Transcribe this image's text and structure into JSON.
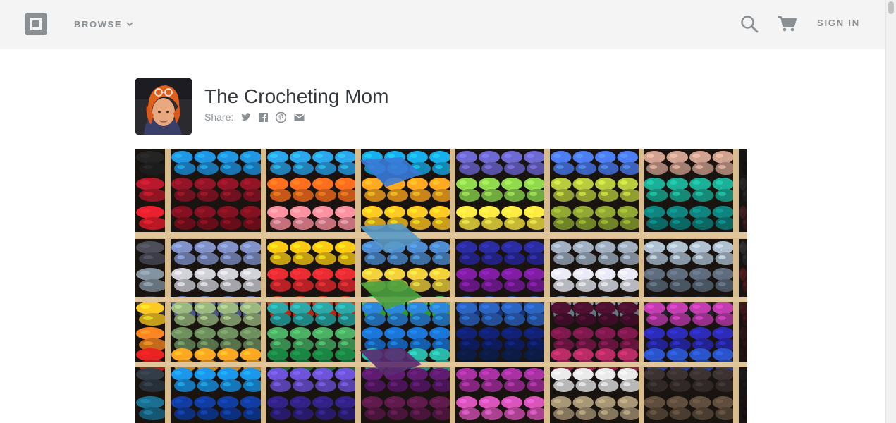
{
  "header": {
    "browse_label": "BROWSE",
    "signin_label": "SIGN IN",
    "icons": [
      "square-logo-icon",
      "chevron-down-icon",
      "search-icon",
      "cart-icon"
    ]
  },
  "store": {
    "title": "The Crocheting Mom",
    "share_label": "Share:",
    "share_icons": [
      "twitter-icon",
      "facebook-icon",
      "pinterest-icon",
      "email-icon"
    ]
  },
  "colors": {
    "header_bg": "#f4f4f4",
    "header_text": "#8a8f94",
    "title_text": "#33383d"
  },
  "hero": {
    "subject": "yarn shelves",
    "yarn_cells": [
      [
        "#222222",
        "#1f8fd8",
        "#2a9fe0",
        "#18a7e0",
        "#6a64c8",
        "#4a78e8",
        "#c89a8a",
        "#111111"
      ],
      [
        "#b0182a",
        "#8a1424",
        "#f06a1c",
        "#f6a21e",
        "#8ad04a",
        "#b0c23a",
        "#1aa890",
        "#222222"
      ],
      [
        "#e01e2c",
        "#7e1020",
        "#f08a98",
        "#f7c020",
        "#f2e040",
        "#8aa030",
        "#0f7f7a",
        "#3a1c1c"
      ],
      [
        "#4a4a56",
        "#7c8cc0",
        "#f0c214",
        "#4a86c8",
        "#2a2a9a",
        "#9aa8b8",
        "#a8b8c8",
        "#2a2a2a"
      ],
      [
        "#7e8c98",
        "#c8c8d0",
        "#e02a30",
        "#e8c83a",
        "#7a1c9a",
        "#e0e0ea",
        "#5a6878",
        "#481818"
      ],
      [
        "#3a3a44",
        "#5a6aa0",
        "#d8321a",
        "#3ab84a",
        "#1d4090",
        "#8090a0",
        "#242830",
        "#2a2a2a"
      ],
      [
        "#f0c020",
        "#94b07a",
        "#2aa0a0",
        "#2a80d0",
        "#2a60b8",
        "#4a1030",
        "#b83aa8",
        "#3a1616"
      ],
      [
        "#f08020",
        "#6a8a5a",
        "#48a860",
        "#1a70d0",
        "#102070",
        "#7a184a",
        "#2a2ab0",
        "#2a1414"
      ],
      [
        "#e02020",
        "#f0a020",
        "#1a8040",
        "#28b0a0",
        "#0a1a40",
        "#b02a60",
        "#2850c0",
        "#201010"
      ],
      [
        "#303a44",
        "#1a90e0",
        "#6a50d0",
        "#5a1a6a",
        "#a0309a",
        "#e0e0e0",
        "#3a3030",
        "#181818"
      ],
      [
        "#1a6a8a",
        "#103a9a",
        "#302080",
        "#5a1a48",
        "#d050b0",
        "#a09070",
        "#5a4a3a",
        "#181010"
      ]
    ]
  }
}
